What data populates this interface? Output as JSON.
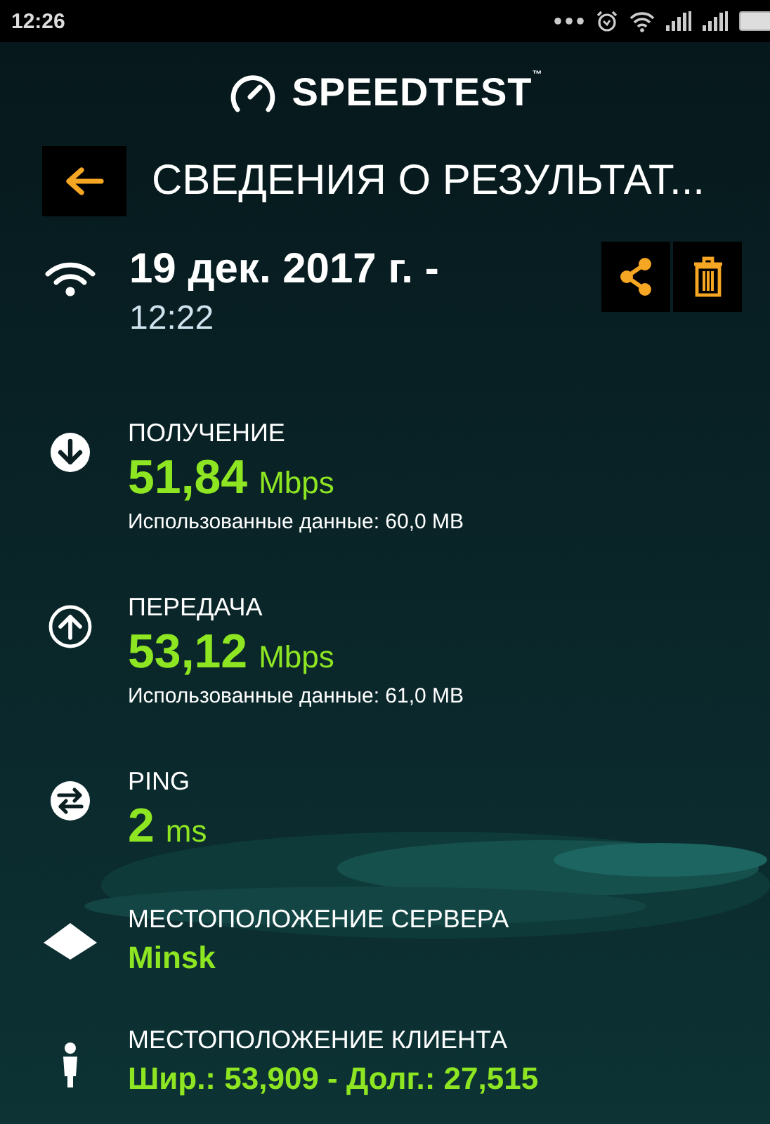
{
  "status_bar": {
    "time": "12:26"
  },
  "app": {
    "logo": "SPEEDTEST",
    "trademark": "™"
  },
  "header": {
    "title": "СВЕДЕНИЯ О РЕЗУЛЬТАТ..."
  },
  "result": {
    "date": "19 дек. 2017 г. -",
    "time": "12:22"
  },
  "sections": [
    {
      "kind": "download",
      "label": "ПОЛУЧЕНИЕ",
      "value": "51,84",
      "unit": "Mbps",
      "used_data": "Использованные данные: 60,0 MB"
    },
    {
      "kind": "upload",
      "label": "ПЕРЕДАЧА",
      "value": "53,12",
      "unit": "Mbps",
      "used_data": "Использованные данные: 61,0 MB"
    },
    {
      "kind": "ping",
      "label": "PING",
      "value": "2",
      "unit": "ms"
    },
    {
      "kind": "server",
      "label": "МЕСТОПОЛОЖЕНИЕ СЕРВЕРА",
      "value": "Minsk"
    },
    {
      "kind": "client",
      "label": "МЕСТОПОЛОЖЕНИЕ КЛИЕНТА",
      "value": "Шир.: 53,909 - Долг.: 27,515"
    }
  ]
}
